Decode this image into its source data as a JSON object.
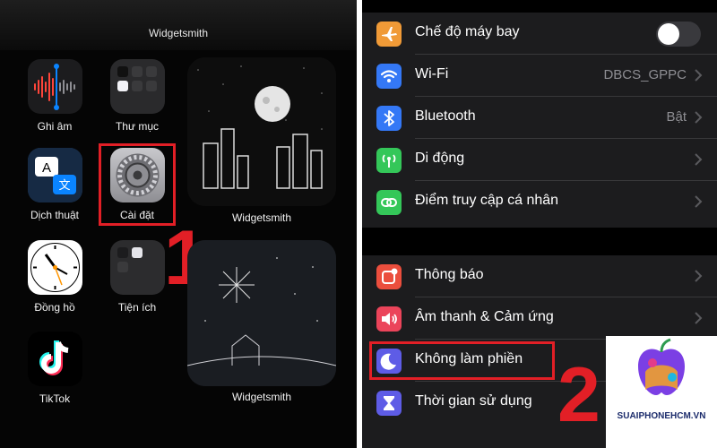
{
  "home": {
    "top_widget_label": "Widgetsmith",
    "apps": [
      {
        "label": "Ghi âm"
      },
      {
        "label": "Thư mục"
      },
      {
        "label": "Dịch thuật"
      },
      {
        "label": "Cài đặt"
      },
      {
        "label": "Đồng hồ"
      },
      {
        "label": "Tiện ích"
      },
      {
        "label": "TikTok"
      }
    ],
    "widgets": [
      {
        "label": "Widgetsmith"
      },
      {
        "label": "Widgetsmith"
      }
    ],
    "step_number": "1"
  },
  "settings": {
    "rows": [
      {
        "label": "Chế độ máy bay",
        "color": "#f09a37"
      },
      {
        "label": "Wi-Fi",
        "value": "DBCS_GPPC",
        "color": "#3478f6"
      },
      {
        "label": "Bluetooth",
        "value": "Bật",
        "color": "#3478f6"
      },
      {
        "label": "Di động",
        "color": "#34c759"
      },
      {
        "label": "Điểm truy cập cá nhân",
        "color": "#34c759"
      },
      {
        "label": "Thông báo",
        "color": "#eb4e3d"
      },
      {
        "label": "Âm thanh & Cảm ứng",
        "color": "#eb445a"
      },
      {
        "label": "Không làm phiền",
        "color": "#5e5ce6"
      },
      {
        "label": "Thời gian sử dụng",
        "color": "#5e5ce6"
      }
    ],
    "airplane_mode_on": false,
    "step_number": "2"
  },
  "watermark": {
    "text": "SUAIPHONEHCM.VN"
  },
  "colors": {
    "highlight": "#e21f26",
    "background": "#000000",
    "cell": "#1c1c1e"
  }
}
